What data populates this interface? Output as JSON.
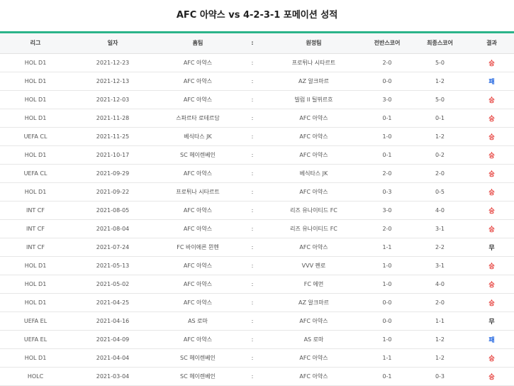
{
  "page": {
    "title": "AFC 아약스 vs 4-2-3-1 포메이션 성적"
  },
  "colors": {
    "accent": "#2bb48a",
    "win": "#e53935",
    "loss": "#1e63e0",
    "draw": "#333333"
  },
  "headers": [
    "리그",
    "일자",
    "홈팀",
    ":",
    "원정팀",
    "전반스코어",
    "최종스코어",
    "결과"
  ],
  "rows": [
    {
      "league": "HOL D1",
      "date": "2021-12-23",
      "home": "AFC 아약스",
      "sep": ":",
      "away": "프로튀나 시타르트",
      "half": "2-0",
      "final": "5-0",
      "result": "승",
      "type": "win"
    },
    {
      "league": "HOL D1",
      "date": "2021-12-13",
      "home": "AFC 아약스",
      "sep": ":",
      "away": "AZ 알크마르",
      "half": "0-0",
      "final": "1-2",
      "result": "패",
      "type": "loss"
    },
    {
      "league": "HOL D1",
      "date": "2021-12-03",
      "home": "AFC 아약스",
      "sep": ":",
      "away": "빌럼 II 틸뷔르흐",
      "half": "3-0",
      "final": "5-0",
      "result": "승",
      "type": "win"
    },
    {
      "league": "HOL D1",
      "date": "2021-11-28",
      "home": "스파르타 로테르담",
      "sep": ":",
      "away": "AFC 아약스",
      "half": "0-1",
      "final": "0-1",
      "result": "승",
      "type": "win"
    },
    {
      "league": "UEFA CL",
      "date": "2021-11-25",
      "home": "베식타스 JK",
      "sep": ":",
      "away": "AFC 아약스",
      "half": "1-0",
      "final": "1-2",
      "result": "승",
      "type": "win"
    },
    {
      "league": "HOL D1",
      "date": "2021-10-17",
      "home": "SC 헤이렌베인",
      "sep": ":",
      "away": "AFC 아약스",
      "half": "0-1",
      "final": "0-2",
      "result": "승",
      "type": "win"
    },
    {
      "league": "UEFA CL",
      "date": "2021-09-29",
      "home": "AFC 아약스",
      "sep": ":",
      "away": "베식타스 JK",
      "half": "2-0",
      "final": "2-0",
      "result": "승",
      "type": "win"
    },
    {
      "league": "HOL D1",
      "date": "2021-09-22",
      "home": "프로튀나 시타르트",
      "sep": ":",
      "away": "AFC 아약스",
      "half": "0-3",
      "final": "0-5",
      "result": "승",
      "type": "win"
    },
    {
      "league": "INT CF",
      "date": "2021-08-05",
      "home": "AFC 아약스",
      "sep": ":",
      "away": "리즈 유나이티드 FC",
      "half": "3-0",
      "final": "4-0",
      "result": "승",
      "type": "win"
    },
    {
      "league": "INT CF",
      "date": "2021-08-04",
      "home": "AFC 아약스",
      "sep": ":",
      "away": "리즈 유나이티드 FC",
      "half": "2-0",
      "final": "3-1",
      "result": "승",
      "type": "win"
    },
    {
      "league": "INT CF",
      "date": "2021-07-24",
      "home": "FC 바이에른 뮌헨",
      "sep": ":",
      "away": "AFC 아약스",
      "half": "1-1",
      "final": "2-2",
      "result": "무",
      "type": "draw"
    },
    {
      "league": "HOL D1",
      "date": "2021-05-13",
      "home": "AFC 아약스",
      "sep": ":",
      "away": "VVV 펜로",
      "half": "1-0",
      "final": "3-1",
      "result": "승",
      "type": "win"
    },
    {
      "league": "HOL D1",
      "date": "2021-05-02",
      "home": "AFC 아약스",
      "sep": ":",
      "away": "FC 에먼",
      "half": "1-0",
      "final": "4-0",
      "result": "승",
      "type": "win"
    },
    {
      "league": "HOL D1",
      "date": "2021-04-25",
      "home": "AFC 아약스",
      "sep": ":",
      "away": "AZ 알크마르",
      "half": "0-0",
      "final": "2-0",
      "result": "승",
      "type": "win"
    },
    {
      "league": "UEFA EL",
      "date": "2021-04-16",
      "home": "AS 로마",
      "sep": ":",
      "away": "AFC 아약스",
      "half": "0-0",
      "final": "1-1",
      "result": "무",
      "type": "draw"
    },
    {
      "league": "UEFA EL",
      "date": "2021-04-09",
      "home": "AFC 아약스",
      "sep": ":",
      "away": "AS 로마",
      "half": "1-0",
      "final": "1-2",
      "result": "패",
      "type": "loss"
    },
    {
      "league": "HOL D1",
      "date": "2021-04-04",
      "home": "SC 헤이렌베인",
      "sep": ":",
      "away": "AFC 아약스",
      "half": "1-1",
      "final": "1-2",
      "result": "승",
      "type": "win"
    },
    {
      "league": "HOLC",
      "date": "2021-03-04",
      "home": "SC 헤이렌베인",
      "sep": ":",
      "away": "AFC 아약스",
      "half": "0-1",
      "final": "0-3",
      "result": "승",
      "type": "win"
    }
  ]
}
